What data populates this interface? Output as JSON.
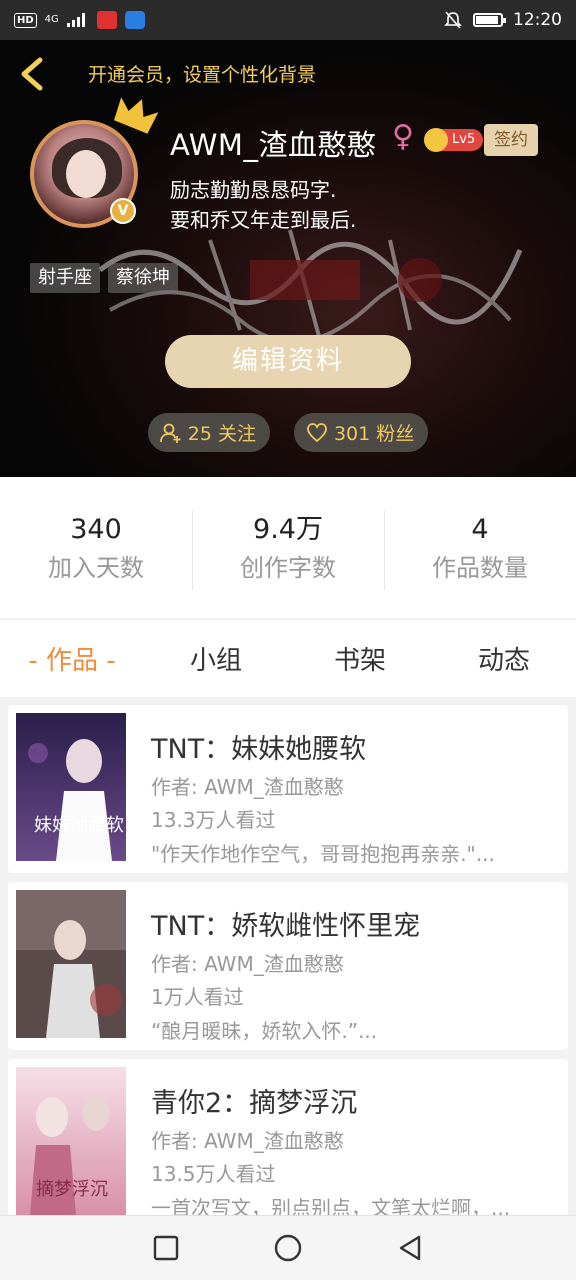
{
  "status_bar": {
    "hd": "HD",
    "signal": "4G",
    "time": "12:20"
  },
  "header": {
    "vip_banner": "开通会员，设置个性化背景",
    "username": "AWM_渣血憨憨",
    "gender_symbol": "♀",
    "level": "Lv5",
    "sign_label": "签约",
    "verified_badge": "V",
    "bio": "励志勤勤恳恳码字.\n要和乔又年走到最后.",
    "tags": [
      "射手座",
      "蔡徐坤"
    ],
    "edit_label": "编辑资料",
    "following": "25 关注",
    "followers": "301 粉丝"
  },
  "stats": [
    {
      "num": "340",
      "label": "加入天数"
    },
    {
      "num": "9.4万",
      "label": "创作字数"
    },
    {
      "num": "4",
      "label": "作品数量"
    }
  ],
  "tabs": [
    "- 作品 -",
    "小组",
    "书架",
    "动态"
  ],
  "books": [
    {
      "title": "TNT：妹妹她腰软",
      "author": "作者: AWM_渣血憨憨",
      "views": "13.3万人看过",
      "desc": "\"作天作地作空气，哥哥抱抱再亲亲.\"...",
      "cover_text": "妹妹她腰软"
    },
    {
      "title": "TNT：娇软雌性怀里宠",
      "author": "作者: AWM_渣血憨憨",
      "views": "1万人看过",
      "desc": "“酿月暖昧，娇软入怀.”...",
      "cover_text": ""
    },
    {
      "title": "青你2：摘梦浮沉",
      "author": "作者: AWM_渣血憨憨",
      "views": "13.5万人看过",
      "desc": "一首次写文，别点别点，文笔太烂啊，...",
      "cover_text": "摘梦浮沉"
    }
  ],
  "colors": {
    "accent": "#f08d3c",
    "gold": "#f3cf57",
    "sign_bg": "#e6d2ac"
  }
}
